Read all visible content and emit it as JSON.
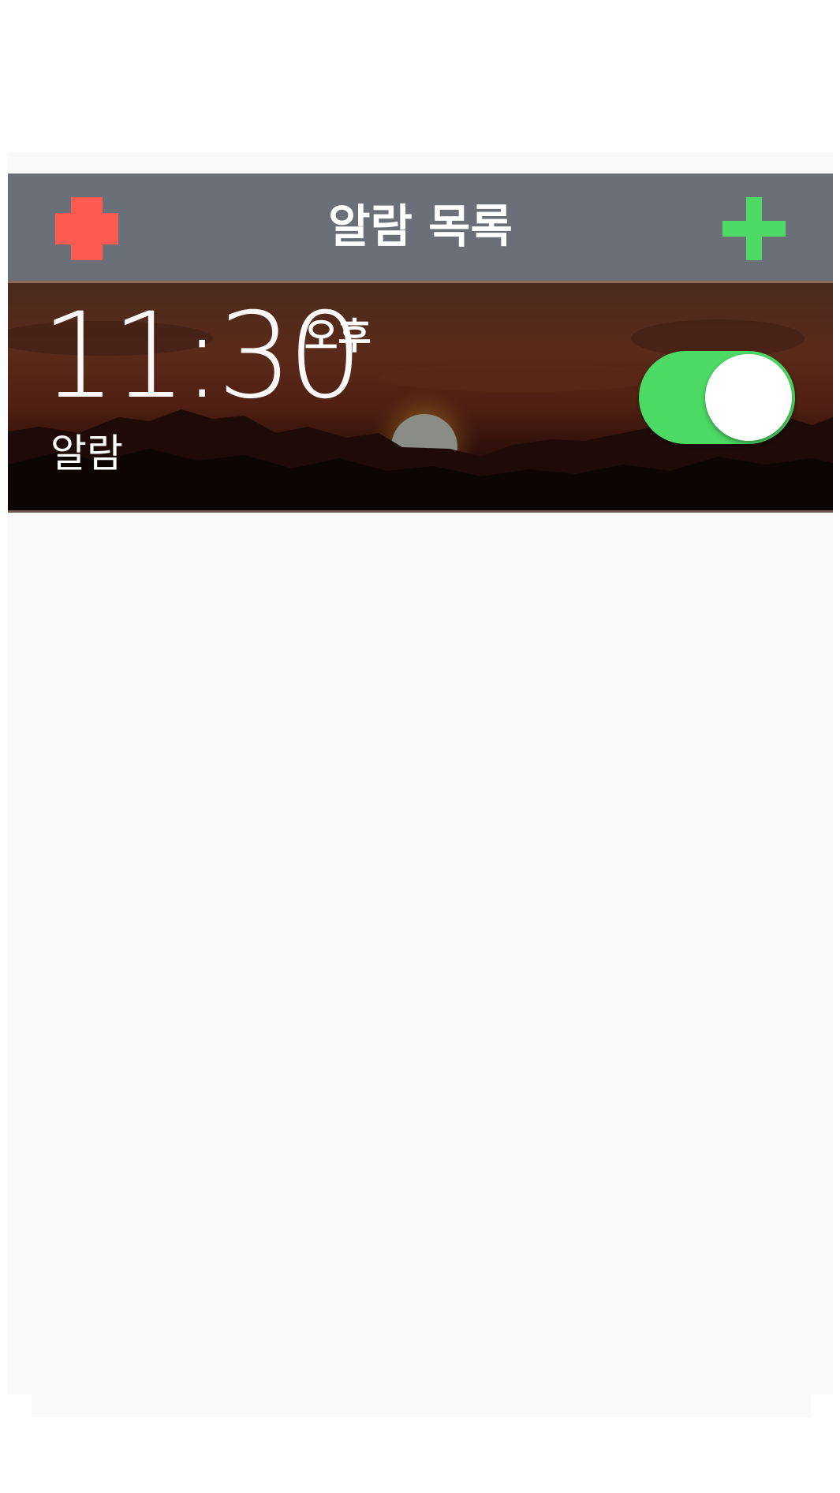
{
  "navbar": {
    "title": "알람 목록",
    "left_icon": "plus-icon",
    "left_icon_color": "#ff5a52",
    "right_icon": "plus-icon",
    "right_icon_color": "#4cd964",
    "background": "#6b7078"
  },
  "alarms": [
    {
      "time": "11:30",
      "ampm": "오후",
      "label": "알람",
      "enabled": true,
      "toggle_color": "#4cd964"
    }
  ],
  "list_background": "#f8f9f9"
}
